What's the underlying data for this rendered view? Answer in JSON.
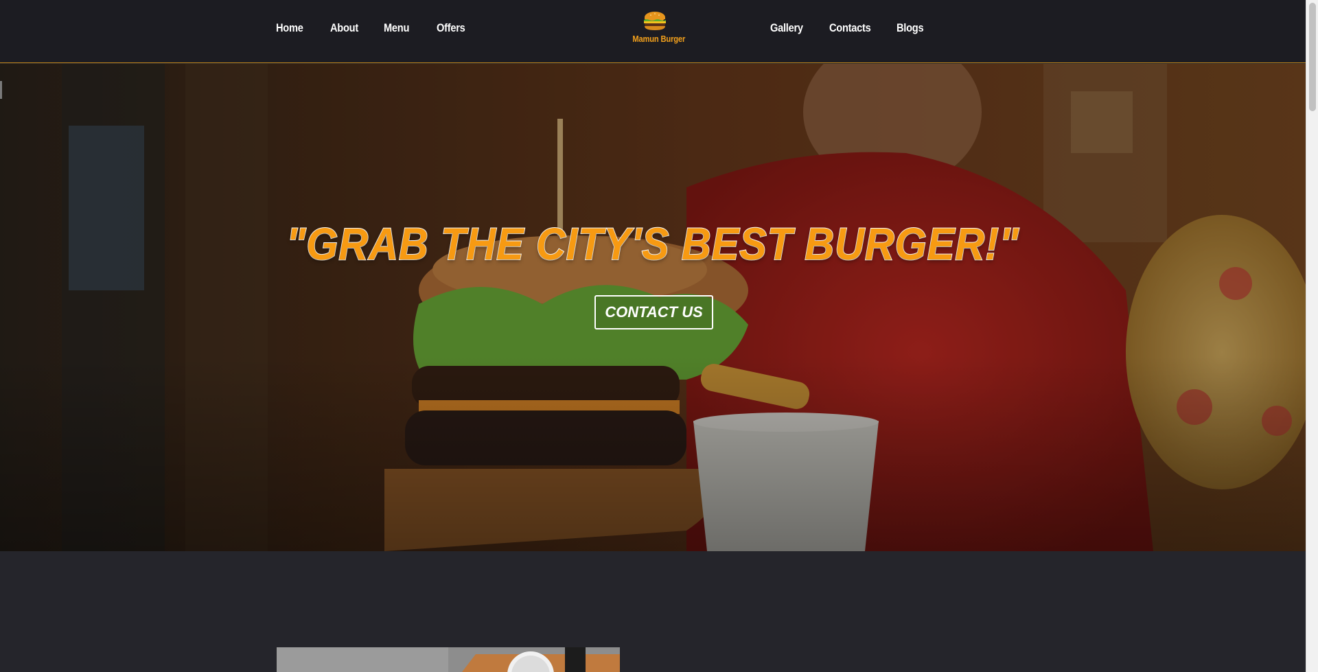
{
  "nav": {
    "left_items": [
      {
        "label": "Home"
      },
      {
        "label": "About"
      },
      {
        "label": "Menu"
      },
      {
        "label": "Offers"
      }
    ],
    "right_items": [
      {
        "label": "Gallery"
      },
      {
        "label": "Contacts"
      },
      {
        "label": "Blogs"
      }
    ],
    "logo": {
      "text": "Mamun Burger",
      "icon": "burger-icon"
    }
  },
  "hero": {
    "headline": "\"GRAB THE CITY'S BEST BURGER!\"",
    "cta_label": "CONTACT US",
    "background": "burger-photo"
  },
  "colors": {
    "accent": "#f79a12",
    "nav_bg": "#1c1c22",
    "page_bg": "#25252b",
    "divider": "#c98a1a"
  },
  "below_hero": {
    "preview_image": "food-photo-thumbnail"
  }
}
